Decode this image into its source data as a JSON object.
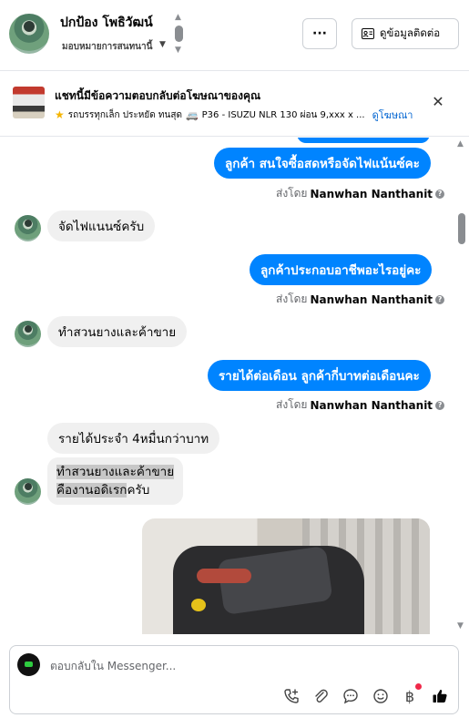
{
  "header": {
    "contact_name": "ปกป้อง โพธิวัฒน์",
    "assign_label": "มอบหมายการสนทนานี้",
    "more_label": "···",
    "contact_info_label": "ดูข้อมูลติดต่อ"
  },
  "ad_banner": {
    "title": "แชทนี้มีข้อความตอบกลับต่อโฆษณาของคุณ",
    "subtitle": "รถบรรทุกเล็ก ประหยัด ทนสุด",
    "subtitle_detail": "P36 - ISUZU NLR 130 ผ่อน 9,xxx x ...",
    "link_label": "ดูโฆษณา",
    "close_label": "✕"
  },
  "messages": [
    {
      "direction": "out",
      "text": "ลูกค้า สนใจซื้อสดหรือจัดไฟแน้นซ์คะ"
    },
    {
      "sent_by_prefix": "ส่งโดย",
      "sent_by_name": "Nanwhan Nanthanit"
    },
    {
      "direction": "in",
      "text": "จัดไฟแนนซ์ครับ"
    },
    {
      "direction": "out",
      "text": "ลูกค้าประกอบอาชีพอะไรอยู่คะ"
    },
    {
      "sent_by_prefix": "ส่งโดย",
      "sent_by_name": "Nanwhan Nanthanit"
    },
    {
      "direction": "in",
      "text": "ทำสวนยางและค้าขาย"
    },
    {
      "direction": "out",
      "text": "รายได้ต่อเดือน ลูกค้ากี่บาทต่อเดือนคะ"
    },
    {
      "sent_by_prefix": "ส่งโดย",
      "sent_by_name": "Nanwhan Nanthanit"
    },
    {
      "direction": "in",
      "text": "รายได้ประจำ 4หมื่นกว่าบาท"
    },
    {
      "direction": "in",
      "line1": "ทำสวนยางและค้าขาย",
      "line2_hl": "คืองานอดิเรก",
      "line2_rest": "ครับ"
    }
  ],
  "composer": {
    "placeholder": "ตอบกลับใน Messenger..."
  },
  "icons": [
    "phone-plus-icon",
    "paperclip-icon",
    "chat-bubble-icon",
    "emoji-icon",
    "baht-icon",
    "thumbs-up-icon"
  ],
  "colors": {
    "accent": "#0084ff",
    "incoming": "#f0f0f0",
    "link": "#0064d1",
    "notify": "#f02849"
  }
}
